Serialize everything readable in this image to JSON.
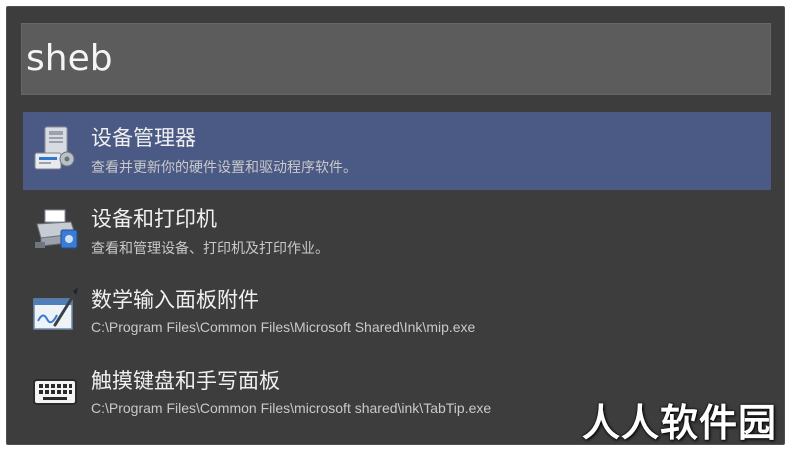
{
  "search": {
    "query": "sheb"
  },
  "results": [
    {
      "title": "设备管理器",
      "subtitle": "查看并更新你的硬件设置和驱动程序软件。",
      "icon": "device-manager-icon",
      "selected": true
    },
    {
      "title": "设备和打印机",
      "subtitle": "查看和管理设备、打印机及打印作业。",
      "icon": "printer-icon",
      "selected": false
    },
    {
      "title": "数学输入面板附件",
      "subtitle": "C:\\Program Files\\Common Files\\Microsoft Shared\\Ink\\mip.exe",
      "icon": "math-input-panel-icon",
      "selected": false
    },
    {
      "title": "触摸键盘和手写面板",
      "subtitle": "C:\\Program Files\\Common Files\\microsoft shared\\ink\\TabTip.exe",
      "icon": "keyboard-icon",
      "selected": false
    }
  ],
  "watermark": "人人软件园",
  "colors": {
    "window_bg": "#3d3d3d",
    "search_bg": "#5c5c5c",
    "selected_bg": "#4a5a85",
    "text": "#f0f0f0",
    "subtext": "#c9c9c9"
  }
}
